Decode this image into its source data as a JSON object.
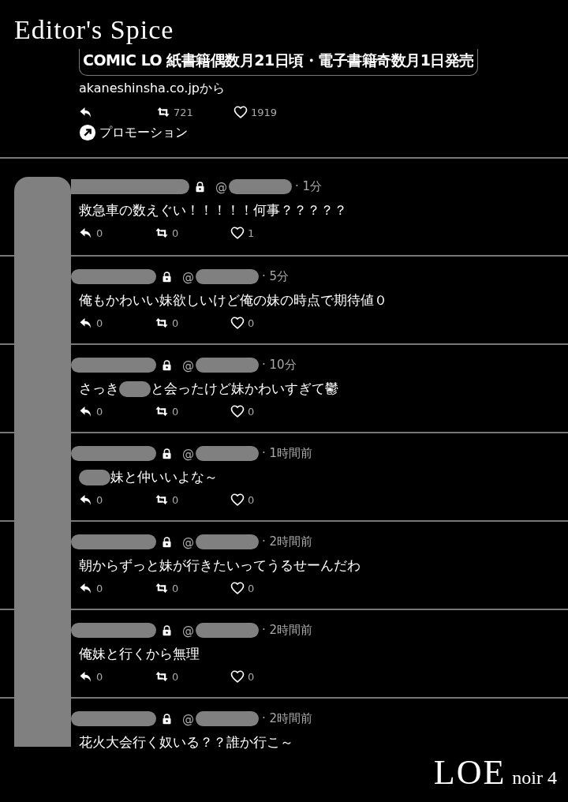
{
  "page_title": "Editor's Spice",
  "promo": {
    "headline": "COMIC LO 紙書籍偶数月21日頃・電子書籍奇数月1日発売",
    "source": "akaneshinsha.co.jpから",
    "retweets": "721",
    "likes": "1919",
    "label": "プロモーション"
  },
  "tweets": [
    {
      "name": {
        "kind": "redacted"
      },
      "at": "@",
      "handle": {
        "kind": "redacted"
      },
      "time": "· 1分",
      "text": [
        {
          "kind": "text",
          "value": "救急車の数えぐい！！！！！何事？？？？？"
        }
      ],
      "replies": "0",
      "retweets": "0",
      "likes": "1"
    },
    {
      "name": {
        "kind": "redacted"
      },
      "at": "@",
      "handle": {
        "kind": "redacted"
      },
      "time": "· 5分",
      "text": [
        {
          "kind": "text",
          "value": "俺もかわいい妹欲しいけど俺の妹の時点で期待値０"
        }
      ],
      "replies": "0",
      "retweets": "0",
      "likes": "0"
    },
    {
      "name": {
        "kind": "redacted"
      },
      "at": "@",
      "handle": {
        "kind": "redacted"
      },
      "time": "· 10分",
      "text": [
        {
          "kind": "text",
          "value": "さっき"
        },
        {
          "kind": "redacted"
        },
        {
          "kind": "text",
          "value": "と会ったけど妹かわいすぎて鬱"
        }
      ],
      "replies": "0",
      "retweets": "0",
      "likes": "0"
    },
    {
      "name": {
        "kind": "redacted"
      },
      "at": "@",
      "handle": {
        "kind": "redacted"
      },
      "time": "· 1時間前",
      "text": [
        {
          "kind": "redacted"
        },
        {
          "kind": "text",
          "value": "妹と仲いいよな～"
        }
      ],
      "replies": "0",
      "retweets": "0",
      "likes": "0"
    },
    {
      "name": {
        "kind": "redacted"
      },
      "at": "@",
      "handle": {
        "kind": "redacted"
      },
      "time": "· 2時間前",
      "text": [
        {
          "kind": "text",
          "value": "朝からずっと妹が行きたいってうるせーんだわ"
        }
      ],
      "replies": "0",
      "retweets": "0",
      "likes": "0"
    },
    {
      "name": {
        "kind": "redacted"
      },
      "at": "@",
      "handle": {
        "kind": "redacted"
      },
      "time": "· 2時間前",
      "text": [
        {
          "kind": "text",
          "value": "俺妹と行くから無理"
        }
      ],
      "replies": "0",
      "retweets": "0",
      "likes": "0"
    },
    {
      "name": {
        "kind": "redacted"
      },
      "at": "@",
      "handle": {
        "kind": "redacted"
      },
      "time": "· 2時間前",
      "text": [
        {
          "kind": "text",
          "value": "花火大会行く奴いる？？誰か行こ～"
        }
      ]
    }
  ],
  "footer": {
    "title": "LOE",
    "subtitle": "noir 4"
  }
}
